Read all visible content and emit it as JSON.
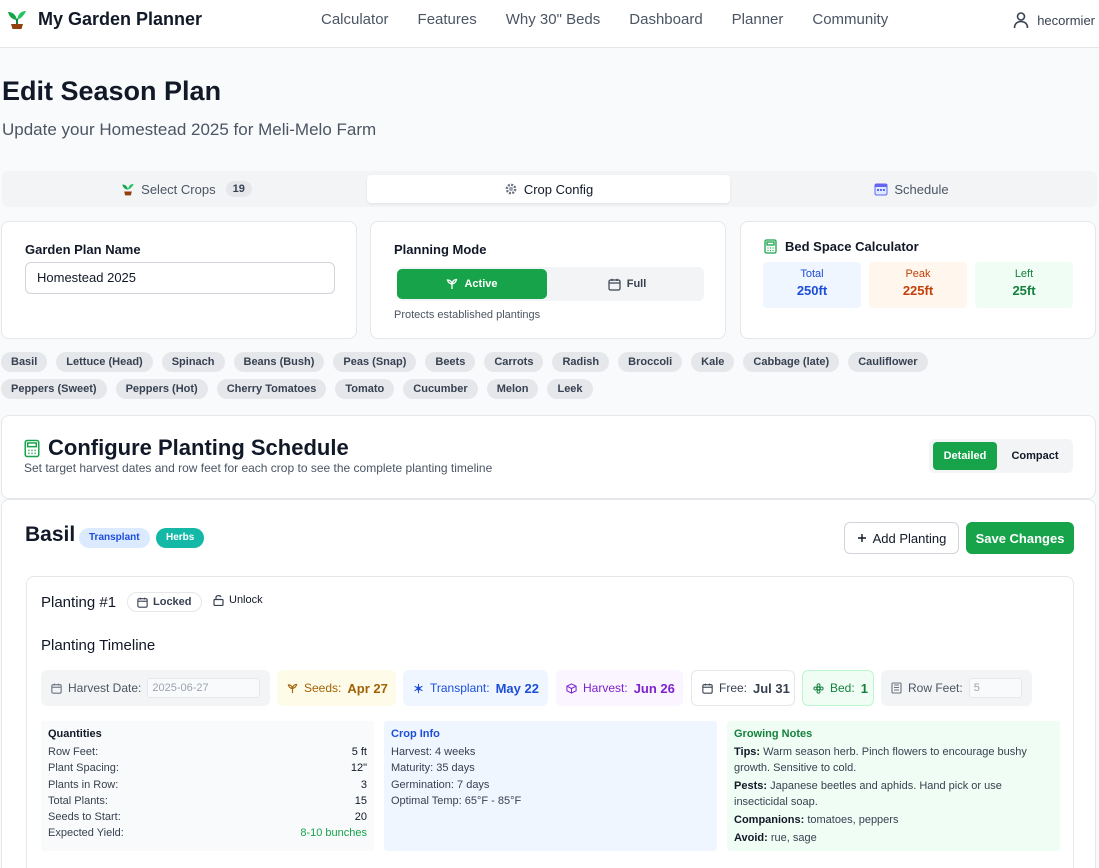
{
  "app": {
    "title": "My Garden Planner",
    "user": "hecormier"
  },
  "nav": [
    "Calculator",
    "Features",
    "Why 30\" Beds",
    "Dashboard",
    "Planner",
    "Community"
  ],
  "page": {
    "title": "Edit Season Plan",
    "subtitle": "Update your Homestead 2025 for Meli-Melo Farm"
  },
  "tabs": [
    {
      "label": "Select Crops",
      "icon": "sprout-icon",
      "count": "19",
      "active": false
    },
    {
      "label": "Crop Config",
      "icon": "gear-icon",
      "active": true
    },
    {
      "label": "Schedule",
      "icon": "calendar-icon",
      "active": false
    }
  ],
  "plan_name": {
    "label": "Garden Plan Name",
    "value": "Homestead 2025"
  },
  "planning_mode": {
    "label": "Planning Mode",
    "active_label": "Active",
    "full_label": "Full",
    "note": "Protects established plantings"
  },
  "bed_space": {
    "title": "Bed Space Calculator",
    "stats": [
      {
        "label": "Total",
        "value": "250ft",
        "color": "#1d4ed8",
        "bg": "#eff6ff"
      },
      {
        "label": "Peak",
        "value": "225ft",
        "color": "#c2410c",
        "bg": "#fff7ed"
      },
      {
        "label": "Left",
        "value": "25ft",
        "color": "#15803d",
        "bg": "#f0fdf4"
      }
    ]
  },
  "crops": [
    "Basil",
    "Lettuce (Head)",
    "Spinach",
    "Beans (Bush)",
    "Peas (Snap)",
    "Beets",
    "Carrots",
    "Radish",
    "Broccoli",
    "Kale",
    "Cabbage (late)",
    "Cauliflower",
    "Peppers (Sweet)",
    "Peppers (Hot)",
    "Cherry Tomatoes",
    "Tomato",
    "Cucumber",
    "Melon",
    "Leek"
  ],
  "configure": {
    "title": "Configure Planting Schedule",
    "subtitle": "Set target harvest dates and row feet for each crop to see the complete planting timeline",
    "view_detailed": "Detailed",
    "view_compact": "Compact"
  },
  "crop_card": {
    "name": "Basil",
    "tag_method": "Transplant",
    "tag_category": "Herbs",
    "add_label": "Add Planting",
    "save_label": "Save Changes",
    "planting": {
      "title": "Planting #1",
      "locked_label": "Locked",
      "unlock_label": "Unlock",
      "timeline_title": "Planting Timeline",
      "harvest_date_label": "Harvest Date:",
      "harvest_date_value": "2025-06-27",
      "seeds_label": "Seeds:",
      "seeds_value": "Apr 27",
      "transplant_label": "Transplant:",
      "transplant_value": "May 22",
      "harvest_label": "Harvest:",
      "harvest_value": "Jun 26",
      "free_label": "Free:",
      "free_value": "Jul 31",
      "bed_label": "Bed:",
      "bed_value": "1",
      "row_feet_label": "Row Feet:",
      "row_feet_value": "5",
      "quantities": {
        "title": "Quantities",
        "rows": [
          {
            "k": "Row Feet:",
            "v": "5 ft"
          },
          {
            "k": "Plant Spacing:",
            "v": "12\""
          },
          {
            "k": "Plants in Row:",
            "v": "3"
          },
          {
            "k": "Total Plants:",
            "v": "15"
          },
          {
            "k": "Seeds to Start:",
            "v": "20"
          },
          {
            "k": "Expected Yield:",
            "v": "8-10 bunches"
          }
        ]
      },
      "crop_info": {
        "title": "Crop Info",
        "lines": [
          "Harvest: 4 weeks",
          "Maturity: 35 days",
          "Germination: 7 days",
          "Optimal Temp: 65°F - 85°F"
        ]
      },
      "notes": {
        "title": "Growing Notes",
        "tips_k": "Tips:",
        "tips_v": "Warm season herb. Pinch flowers to encourage bushy growth. Sensitive to cold.",
        "pests_k": "Pests:",
        "pests_v": "Japanese beetles and aphids. Hand pick or use insecticidal soap.",
        "comp_k": "Companions:",
        "comp_v": "tomatoes, peppers",
        "avoid_k": "Avoid:",
        "avoid_v": "rue, sage"
      }
    }
  },
  "colors": {
    "brand_green": "#16a34a"
  }
}
